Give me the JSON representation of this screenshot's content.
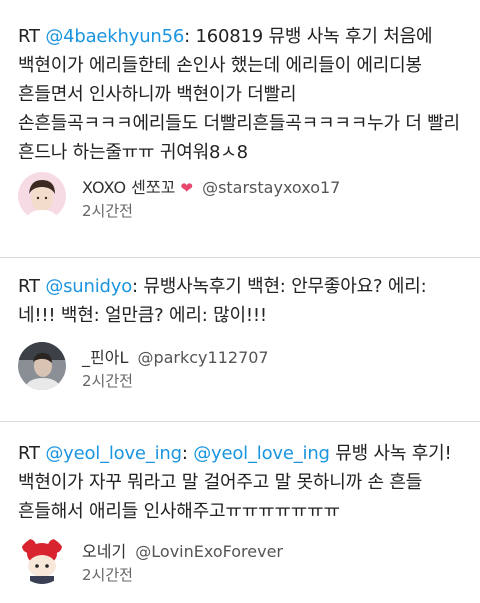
{
  "tweets": [
    {
      "prefix": "RT ",
      "mention1": "@4baekhyun56",
      "text": ": 160819 뮤뱅 사녹 후기 처음에 백현이가 에리들한테 손인사 했는데 에리들이 에리디봉 흔들면서 인사하니까 백현이가 더빨리 손흔들곡ㅋㅋㅋ에리들도 더빨리흔들곡ㅋㅋㅋㅋ누가 더 빨리 흔드나 하는줄ㅠㅠ 귀여워8ㅅ8",
      "author_name": "XOXO 센쪼꼬",
      "author_emoji": "❤",
      "handle": "@starstayxoxo17",
      "time": "2시간전",
      "avatar_icon": "person-avatar-icon"
    },
    {
      "prefix": "RT ",
      "mention1": "@sunidyo",
      "text": ": 뮤뱅사녹후기 백현: 안무좋아요? 에리: 네!!! 백현: 얼만큼? 에리: 많이!!!",
      "author_name": "_핀아L",
      "handle": "@parkcy112707",
      "time": "2시간전",
      "avatar_icon": "person-avatar-icon"
    },
    {
      "prefix": "RT ",
      "mention1": "@yeol_love_ing",
      "sep": ": ",
      "mention2": "@yeol_love_ing",
      "text": " 뮤뱅 사녹 후기! 백현이가 자꾸 뭐라고 말 걸어주고 말 못하니까 손 흔들 흔들해서 애리들 인사해주고ㅠㅠㅠㅠㅠㅠㅠ",
      "author_name": "오네기",
      "handle": "@LovinExoForever",
      "time": "2시간전",
      "avatar_icon": "cartoon-character-avatar-icon"
    }
  ],
  "colors": {
    "mention": "#1b95e0",
    "divider": "#dcdcdc",
    "heart": "#e8466c"
  }
}
